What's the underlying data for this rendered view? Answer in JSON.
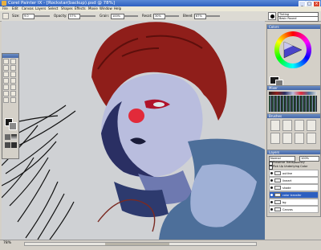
{
  "window": {
    "title": "Corel Painter IX - [Rockstar(backup).psd @ 78%]"
  },
  "menu": [
    "File",
    "Edit",
    "Canvas",
    "Layers",
    "Select",
    "Shapes",
    "Effects",
    "Movie",
    "Window",
    "Help"
  ],
  "property_bar": {
    "size_label": "Size:",
    "size_value": "9.0",
    "opacity_label": "Opacity:",
    "opacity_value": "57%",
    "grain_label": "Grain:",
    "grain_value": "100%",
    "resat_label": "Resat:",
    "resat_value": "30%",
    "bleed_label": "Bleed:",
    "bleed_value": "67%"
  },
  "brush_selector": {
    "category": "Tinting",
    "variant": "Basic Round"
  },
  "panels": {
    "colors_title": "Colors",
    "mixer_title": "Mixer",
    "brush_title": "Brushes",
    "layers_title": "Layers"
  },
  "layers": {
    "composite_method": "Normal",
    "opacity": "100%",
    "preserve_transparency": "Preserve Transparency",
    "pick_up_color": "Pick Up Underlying Color",
    "items": [
      {
        "name": "outline",
        "selected": false
      },
      {
        "name": "lineart",
        "selected": false
      },
      {
        "name": "shade",
        "selected": false
      },
      {
        "name": "color transfer",
        "selected": true
      },
      {
        "name": "bg",
        "selected": false
      },
      {
        "name": "Canvas",
        "selected": false
      }
    ]
  },
  "statusbar": {
    "zoom": "78%"
  },
  "colors": {
    "titlebar": "#2d5fc0",
    "hair": "#8f1e1a",
    "skin_shadow": "#2a2f63",
    "panel": "#d4d0c8"
  }
}
